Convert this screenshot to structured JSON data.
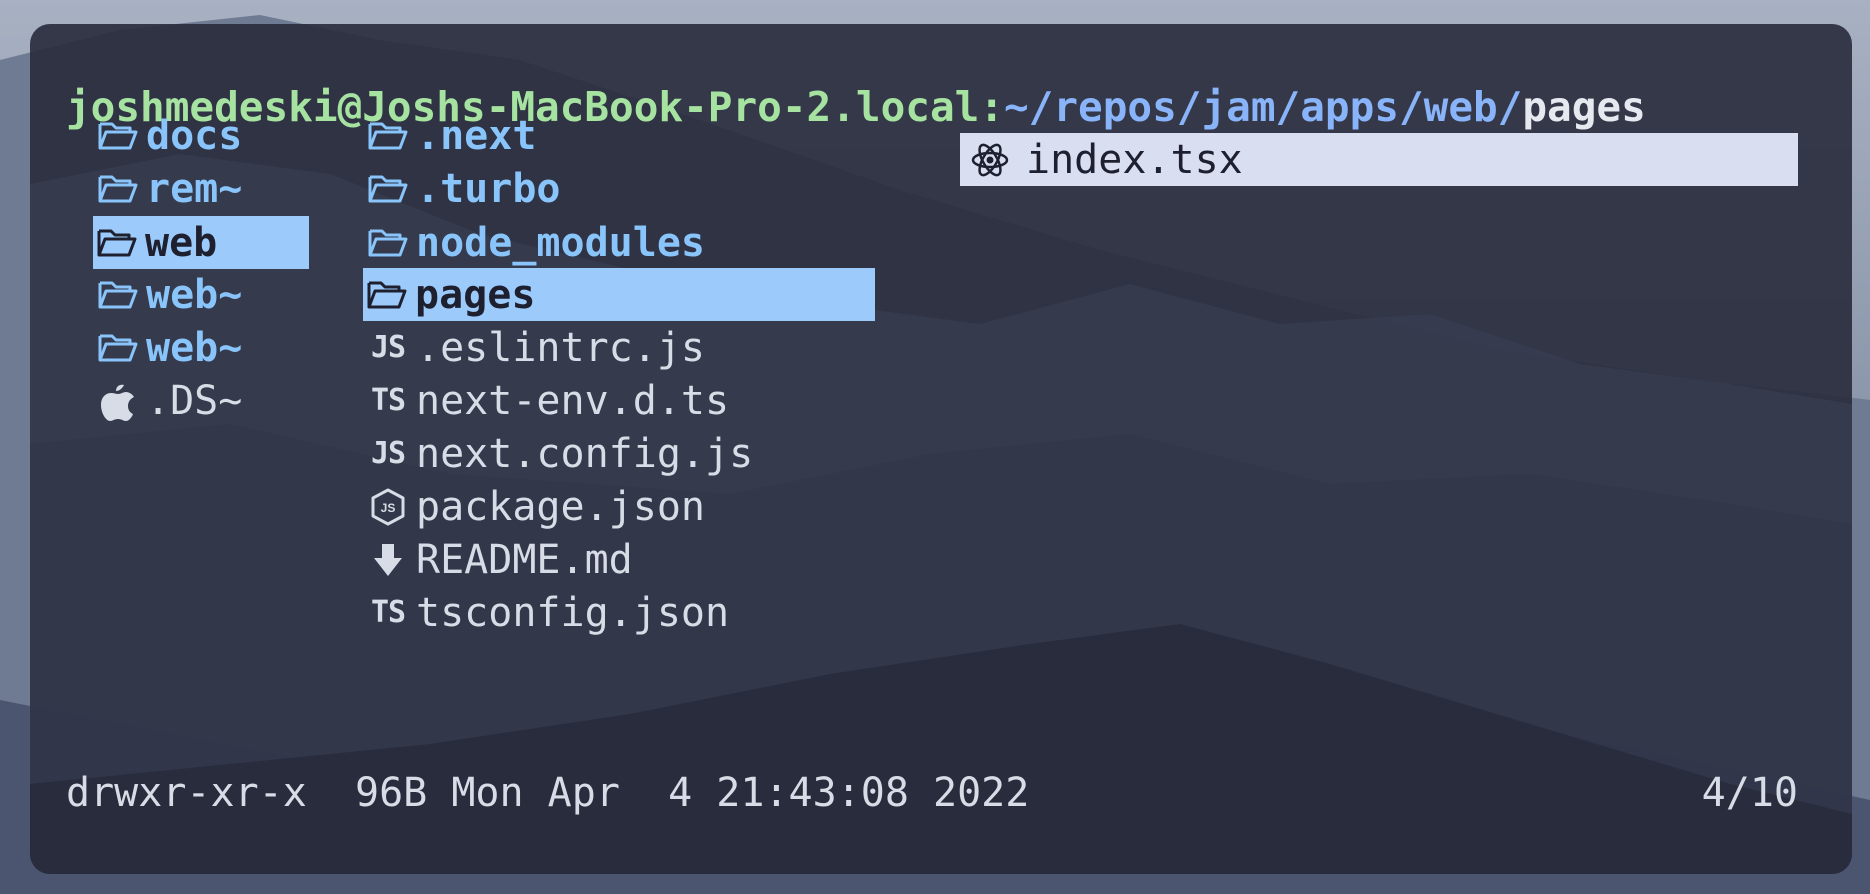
{
  "prompt": {
    "user_host": "joshmedeski@Joshs-MacBook-Pro-2.local",
    "separator": ":",
    "path": "~/repos/jam/apps/web/",
    "current": "pages"
  },
  "parent_column": [
    {
      "name": "docs",
      "icon": "folder-icon",
      "kind": "dir"
    },
    {
      "name": "rem~",
      "icon": "folder-icon",
      "kind": "dir"
    },
    {
      "name": "web",
      "icon": "folder-icon",
      "kind": "dir",
      "selected": true
    },
    {
      "name": "web~",
      "icon": "folder-icon",
      "kind": "dir"
    },
    {
      "name": "web~",
      "icon": "folder-icon",
      "kind": "dir"
    },
    {
      "name": ".DS~",
      "icon": "apple-icon",
      "kind": "file"
    }
  ],
  "current_column": [
    {
      "name": ".next",
      "icon": "folder-icon",
      "kind": "dir"
    },
    {
      "name": ".turbo",
      "icon": "folder-icon",
      "kind": "dir"
    },
    {
      "name": "node_modules",
      "icon": "folder-icon",
      "kind": "dir"
    },
    {
      "name": "pages",
      "icon": "folder-icon",
      "kind": "dir",
      "selected": true
    },
    {
      "name": ".eslintrc.js",
      "icon": "javascript-icon",
      "icon_text": "JS",
      "kind": "file"
    },
    {
      "name": "next-env.d.ts",
      "icon": "typescript-icon",
      "icon_text": "TS",
      "kind": "file"
    },
    {
      "name": "next.config.js",
      "icon": "javascript-icon",
      "icon_text": "JS",
      "kind": "file"
    },
    {
      "name": "package.json",
      "icon": "nodejs-icon",
      "kind": "file"
    },
    {
      "name": "README.md",
      "icon": "markdown-download-icon",
      "kind": "file"
    },
    {
      "name": "tsconfig.json",
      "icon": "typescript-icon",
      "icon_text": "TS",
      "kind": "file"
    }
  ],
  "preview_column": [
    {
      "name": "index.tsx",
      "icon": "react-icon",
      "kind": "file"
    }
  ],
  "status": {
    "permissions": "drwxr-xr-x",
    "size": "96B",
    "date": "Mon Apr  4 21:43:08 2022",
    "position": "4/10"
  },
  "colors": {
    "directory": "#89c4fa",
    "selection": "#9ccbfb",
    "prompt_user": "#a6e3a1",
    "prompt_path": "#89b4fa",
    "terminal_bg": "#282b3c"
  }
}
